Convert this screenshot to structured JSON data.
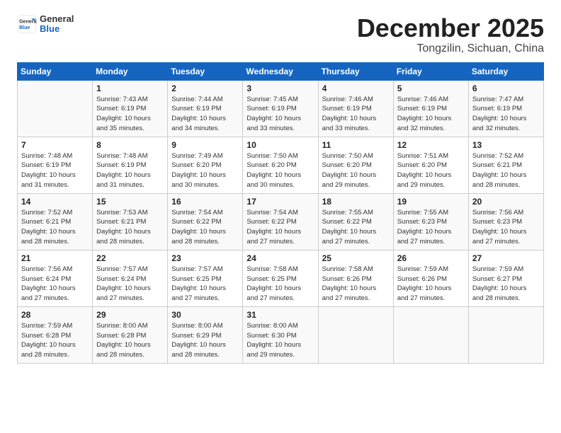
{
  "logo": {
    "line1": "General",
    "line2": "Blue"
  },
  "title": "December 2025",
  "subtitle": "Tongzilin, Sichuan, China",
  "days_of_week": [
    "Sunday",
    "Monday",
    "Tuesday",
    "Wednesday",
    "Thursday",
    "Friday",
    "Saturday"
  ],
  "weeks": [
    [
      {
        "day": "",
        "info": ""
      },
      {
        "day": "1",
        "info": "Sunrise: 7:43 AM\nSunset: 6:19 PM\nDaylight: 10 hours\nand 35 minutes."
      },
      {
        "day": "2",
        "info": "Sunrise: 7:44 AM\nSunset: 6:19 PM\nDaylight: 10 hours\nand 34 minutes."
      },
      {
        "day": "3",
        "info": "Sunrise: 7:45 AM\nSunset: 6:19 PM\nDaylight: 10 hours\nand 33 minutes."
      },
      {
        "day": "4",
        "info": "Sunrise: 7:46 AM\nSunset: 6:19 PM\nDaylight: 10 hours\nand 33 minutes."
      },
      {
        "day": "5",
        "info": "Sunrise: 7:46 AM\nSunset: 6:19 PM\nDaylight: 10 hours\nand 32 minutes."
      },
      {
        "day": "6",
        "info": "Sunrise: 7:47 AM\nSunset: 6:19 PM\nDaylight: 10 hours\nand 32 minutes."
      }
    ],
    [
      {
        "day": "7",
        "info": "Sunrise: 7:48 AM\nSunset: 6:19 PM\nDaylight: 10 hours\nand 31 minutes."
      },
      {
        "day": "8",
        "info": "Sunrise: 7:48 AM\nSunset: 6:19 PM\nDaylight: 10 hours\nand 31 minutes."
      },
      {
        "day": "9",
        "info": "Sunrise: 7:49 AM\nSunset: 6:20 PM\nDaylight: 10 hours\nand 30 minutes."
      },
      {
        "day": "10",
        "info": "Sunrise: 7:50 AM\nSunset: 6:20 PM\nDaylight: 10 hours\nand 30 minutes."
      },
      {
        "day": "11",
        "info": "Sunrise: 7:50 AM\nSunset: 6:20 PM\nDaylight: 10 hours\nand 29 minutes."
      },
      {
        "day": "12",
        "info": "Sunrise: 7:51 AM\nSunset: 6:20 PM\nDaylight: 10 hours\nand 29 minutes."
      },
      {
        "day": "13",
        "info": "Sunrise: 7:52 AM\nSunset: 6:21 PM\nDaylight: 10 hours\nand 28 minutes."
      }
    ],
    [
      {
        "day": "14",
        "info": "Sunrise: 7:52 AM\nSunset: 6:21 PM\nDaylight: 10 hours\nand 28 minutes."
      },
      {
        "day": "15",
        "info": "Sunrise: 7:53 AM\nSunset: 6:21 PM\nDaylight: 10 hours\nand 28 minutes."
      },
      {
        "day": "16",
        "info": "Sunrise: 7:54 AM\nSunset: 6:22 PM\nDaylight: 10 hours\nand 28 minutes."
      },
      {
        "day": "17",
        "info": "Sunrise: 7:54 AM\nSunset: 6:22 PM\nDaylight: 10 hours\nand 27 minutes."
      },
      {
        "day": "18",
        "info": "Sunrise: 7:55 AM\nSunset: 6:22 PM\nDaylight: 10 hours\nand 27 minutes."
      },
      {
        "day": "19",
        "info": "Sunrise: 7:55 AM\nSunset: 6:23 PM\nDaylight: 10 hours\nand 27 minutes."
      },
      {
        "day": "20",
        "info": "Sunrise: 7:56 AM\nSunset: 6:23 PM\nDaylight: 10 hours\nand 27 minutes."
      }
    ],
    [
      {
        "day": "21",
        "info": "Sunrise: 7:56 AM\nSunset: 6:24 PM\nDaylight: 10 hours\nand 27 minutes."
      },
      {
        "day": "22",
        "info": "Sunrise: 7:57 AM\nSunset: 6:24 PM\nDaylight: 10 hours\nand 27 minutes."
      },
      {
        "day": "23",
        "info": "Sunrise: 7:57 AM\nSunset: 6:25 PM\nDaylight: 10 hours\nand 27 minutes."
      },
      {
        "day": "24",
        "info": "Sunrise: 7:58 AM\nSunset: 6:25 PM\nDaylight: 10 hours\nand 27 minutes."
      },
      {
        "day": "25",
        "info": "Sunrise: 7:58 AM\nSunset: 6:26 PM\nDaylight: 10 hours\nand 27 minutes."
      },
      {
        "day": "26",
        "info": "Sunrise: 7:59 AM\nSunset: 6:26 PM\nDaylight: 10 hours\nand 27 minutes."
      },
      {
        "day": "27",
        "info": "Sunrise: 7:59 AM\nSunset: 6:27 PM\nDaylight: 10 hours\nand 28 minutes."
      }
    ],
    [
      {
        "day": "28",
        "info": "Sunrise: 7:59 AM\nSunset: 6:28 PM\nDaylight: 10 hours\nand 28 minutes."
      },
      {
        "day": "29",
        "info": "Sunrise: 8:00 AM\nSunset: 6:28 PM\nDaylight: 10 hours\nand 28 minutes."
      },
      {
        "day": "30",
        "info": "Sunrise: 8:00 AM\nSunset: 6:29 PM\nDaylight: 10 hours\nand 28 minutes."
      },
      {
        "day": "31",
        "info": "Sunrise: 8:00 AM\nSunset: 6:30 PM\nDaylight: 10 hours\nand 29 minutes."
      },
      {
        "day": "",
        "info": ""
      },
      {
        "day": "",
        "info": ""
      },
      {
        "day": "",
        "info": ""
      }
    ]
  ]
}
